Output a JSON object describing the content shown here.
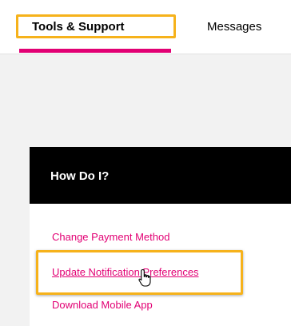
{
  "nav": {
    "tabs": [
      {
        "label": "Tools & Support",
        "active": true
      },
      {
        "label": "Messages"
      }
    ]
  },
  "how_do_i": {
    "title": "How Do I?",
    "links": [
      {
        "label": "Change Payment Method"
      },
      {
        "label": "Update Notification Preferences"
      },
      {
        "label": "Download Mobile App"
      }
    ]
  },
  "colors": {
    "accent": "#e20074",
    "highlight": "#f6b21b",
    "header_bg": "#000000"
  },
  "icons": {
    "cursor": "hand-pointer-icon"
  }
}
